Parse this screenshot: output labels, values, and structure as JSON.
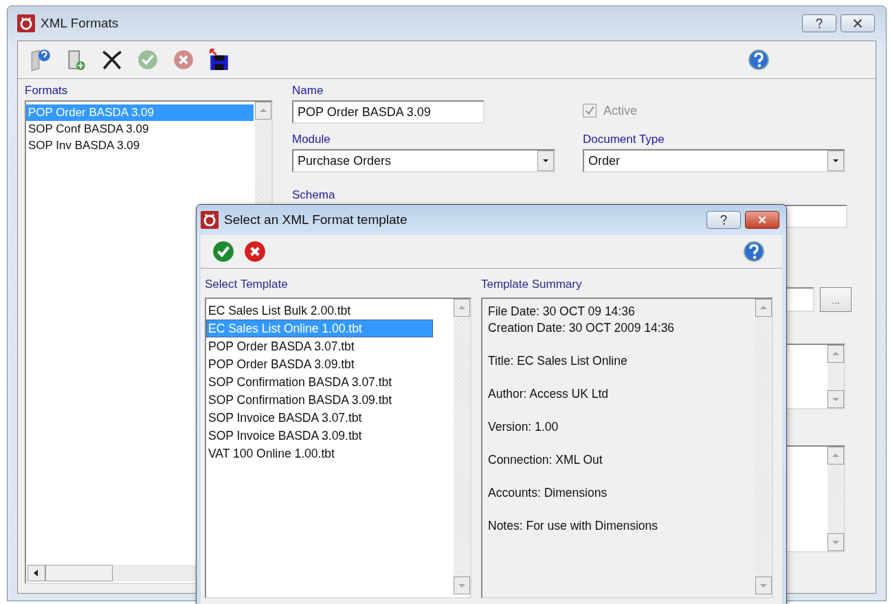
{
  "window": {
    "title": "XML Formats"
  },
  "toolbar": [
    {
      "kind": "properties",
      "disabled": false
    },
    {
      "kind": "new",
      "disabled": false
    },
    {
      "kind": "delete",
      "disabled": false
    },
    {
      "kind": "accept",
      "disabled": true
    },
    {
      "kind": "cancel",
      "disabled": true
    },
    {
      "kind": "import",
      "disabled": false
    }
  ],
  "formats": {
    "label": "Formats",
    "items": [
      {
        "text": "POP Order BASDA 3.09",
        "selected": true
      },
      {
        "text": "SOP Conf BASDA 3.09",
        "selected": false
      },
      {
        "text": "SOP Inv BASDA 3.09",
        "selected": false
      }
    ]
  },
  "form": {
    "name_label": "Name",
    "name_value": "POP Order BASDA 3.09",
    "active": {
      "label": "Active",
      "checked": true,
      "disabled": true
    },
    "module_label": "Module",
    "module_value": "Purchase Orders",
    "document_type_label": "Document Type",
    "document_type_value": "Order",
    "schema_label": "Schema",
    "browse_button": "..."
  },
  "dialog": {
    "title": "Select an XML Format template",
    "select_label": "Select Template",
    "templates": [
      {
        "text": "EC Sales List Bulk 2.00.tbt",
        "selected": false
      },
      {
        "text": "EC Sales List Online 1.00.tbt",
        "selected": true
      },
      {
        "text": "POP Order BASDA 3.07.tbt",
        "selected": false
      },
      {
        "text": "POP Order BASDA 3.09.tbt",
        "selected": false
      },
      {
        "text": "SOP Confirmation BASDA 3.07.tbt",
        "selected": false
      },
      {
        "text": "SOP Confirmation BASDA 3.09.tbt",
        "selected": false
      },
      {
        "text": "SOP Invoice BASDA 3.07.tbt",
        "selected": false
      },
      {
        "text": "SOP Invoice BASDA 3.09.tbt",
        "selected": false
      },
      {
        "text": "VAT 100 Online 1.00.tbt",
        "selected": false
      }
    ],
    "summary_label": "Template Summary",
    "summary_blocks": [
      [
        "File Date: 30 OCT 09 14:36",
        "Creation Date: 30 OCT 2009 14:36"
      ],
      [
        "Title: EC Sales List Online"
      ],
      [
        "Author: Access UK Ltd"
      ],
      [
        "Version: 1.00"
      ],
      [
        "Connection: XML Out"
      ],
      [
        "Accounts: Dimensions"
      ],
      [
        "Notes: For use with Dimensions"
      ]
    ]
  }
}
